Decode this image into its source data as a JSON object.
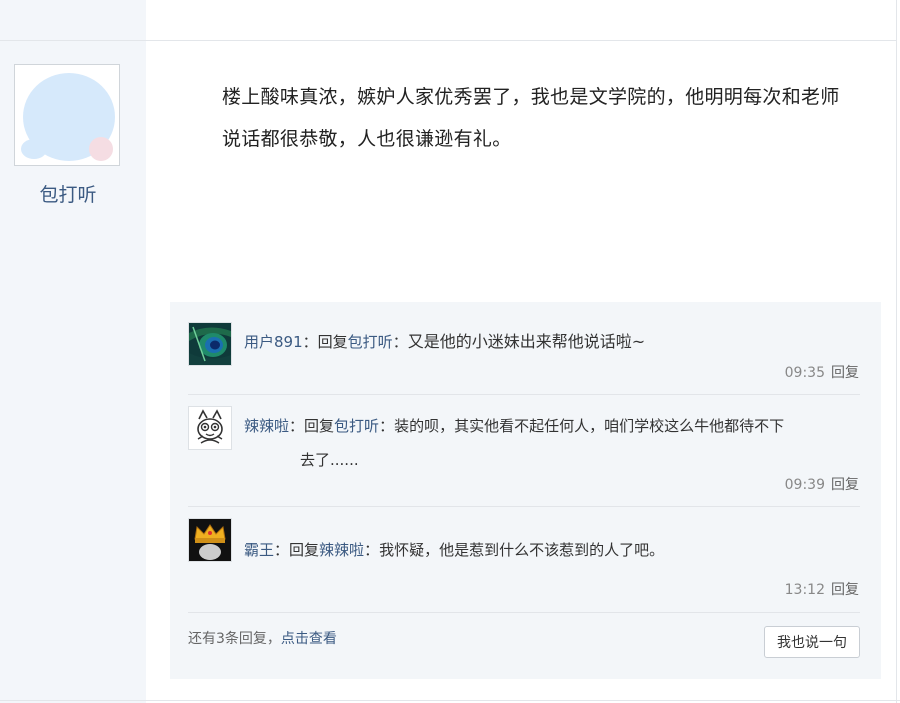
{
  "post": {
    "author": "包打听",
    "content": "楼上酸味真浓，嫉妒人家优秀罢了，我也是文学院的，他明明每次和老师说话都很恭敬，人也很谦逊有礼。"
  },
  "replies": [
    {
      "user": "用户891",
      "sep": "：",
      "reply_word": "回复",
      "target": "包打听",
      "content": "又是他的小迷妹出来帮他说话啦~",
      "time": "09:35",
      "reply_label": "回复",
      "avatar_icon": "peacock-feather-icon"
    },
    {
      "user": "辣辣啦",
      "sep": "：",
      "reply_word": "回复",
      "target": "包打听",
      "content": "装的呗，其实他看不起任何人，咱们学校这么牛他都待不下",
      "content_cont": "去了......",
      "time": "09:39",
      "reply_label": "回复",
      "avatar_icon": "cartoon-cat-icon"
    },
    {
      "user": "霸王",
      "sep": "：",
      "reply_word": "回复",
      "target": "辣辣啦",
      "content": "我怀疑，他是惹到什么不该惹到的人了吧。",
      "time": "13:12",
      "reply_label": "回复",
      "avatar_icon": "crown-icon"
    }
  ],
  "footer": {
    "more_prefix": "还有3条回复，",
    "more_link": "点击查看",
    "say_button": "我也说一句"
  },
  "colors": {
    "link": "#3b5a82",
    "panel_bg": "#f3f6f9",
    "sidebar_bg": "#f3f6fa"
  }
}
